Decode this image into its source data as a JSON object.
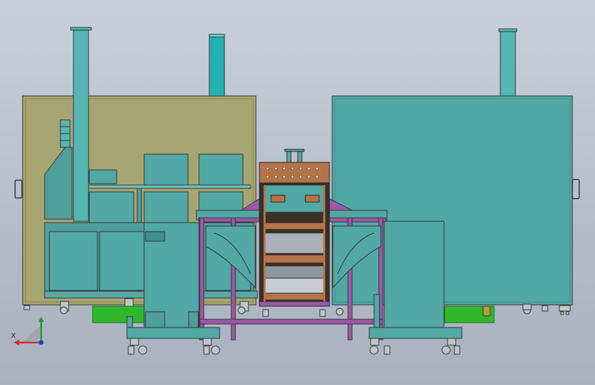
{
  "view": {
    "background_top": "#c9d0db",
    "background_bottom": "#a9b1bf",
    "style": "shaded with edges"
  },
  "triad": {
    "x_axis_label": "X",
    "x_color": "#e0242b",
    "y_color": "#1f9b2e",
    "z_color": "#1e3fd0"
  },
  "palette": {
    "olive_cabinet": "#a7a672",
    "teal_panel": "#52a8a4",
    "teal_dark": "#3f8f8c",
    "stack": "#56b6b4",
    "purple_frame": "#9b59a8",
    "copper_module": "#b5734a",
    "green_base": "#2fb82b"
  }
}
